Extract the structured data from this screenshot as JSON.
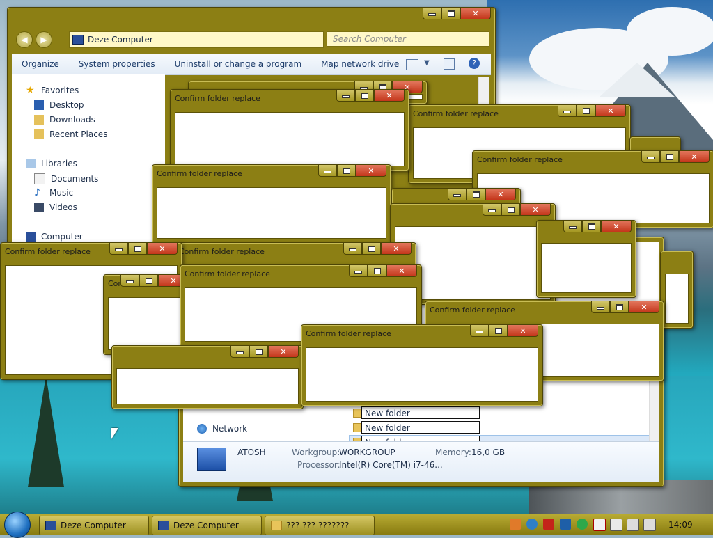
{
  "explorer": {
    "address": "Deze Computer",
    "search_placeholder": "Search Computer",
    "toolbar": [
      "Organize",
      "System properties",
      "Uninstall or change a program",
      "Map network drive"
    ],
    "nav": {
      "favorites": "Favorites",
      "desktop": "Desktop",
      "downloads": "Downloads",
      "recent": "Recent Places",
      "libraries": "Libraries",
      "documents": "Documents",
      "music": "Music",
      "videos": "Videos",
      "computer": "Computer"
    }
  },
  "dialog": {
    "title": "Confirm folder replace"
  },
  "explorer2": {
    "network": "Network",
    "folders": [
      "New folder",
      "New folder",
      "New folder"
    ],
    "details": {
      "name": "ATOSH",
      "workgroup_label": "Workgroup:",
      "workgroup": "WORKGROUP",
      "memory_label": "Memory:",
      "memory": "16,0 GB",
      "processor_label": "Processor:",
      "processor": "Intel(R) Core(TM) i7-46..."
    }
  },
  "taskbar": {
    "items": [
      "Deze Computer",
      "Deze Computer",
      "??? ??? ???????"
    ],
    "clock": "14:09"
  },
  "colors": {
    "chrome": "#8c7f14",
    "close": "#c4361b"
  }
}
